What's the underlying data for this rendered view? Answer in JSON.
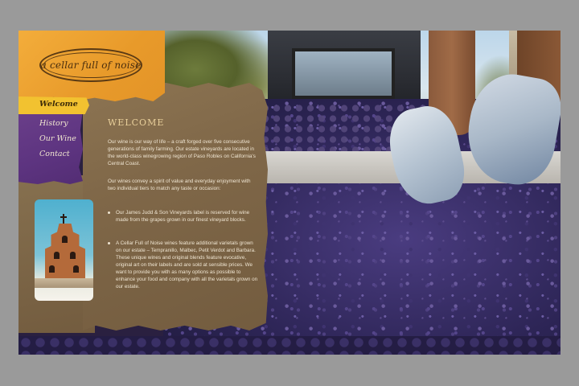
{
  "site": {
    "logo_text": "a cellar full of noise"
  },
  "nav": {
    "items": [
      {
        "label": "Welcome",
        "active": true
      },
      {
        "label": "History",
        "active": false
      },
      {
        "label": "Our Wine",
        "active": false
      },
      {
        "label": "Contact",
        "active": false
      }
    ]
  },
  "content": {
    "heading": "WELCOME",
    "p1": "Our wine is our way of life – a craft forged over five consecutive generations of family farming. Our estate vineyards are located in the world-class winegrowing region of Paso Robles on California's Central Coast.",
    "p2": "Our wines convey a spirit of value and everyday enjoyment with two individual tiers to match any taste or occasion:",
    "bullets": [
      "Our James Judd & Son Vineyards label is reserved for wine made from the grapes grown in our finest vineyard blocks.",
      "A Cellar Full of Noise wines feature additional varietals grown on our estate – Tempranillo, Malbec, Petit Verdot and Barbara. These unique wines and original blends feature evocative, original art on their labels and are sold at sensible prices. We want to provide you with as many options as possible to enhance your food and company with all the varietals grown on our estate."
    ]
  },
  "colors": {
    "orange_panel": "#e89a2a",
    "purple_nav": "#5d3480",
    "yellow_active_tab": "#f2c230",
    "kraft_paper": "#7f6748",
    "heading": "#e8cf9a"
  },
  "icons": [
    "mission-bell-tower-photo"
  ]
}
